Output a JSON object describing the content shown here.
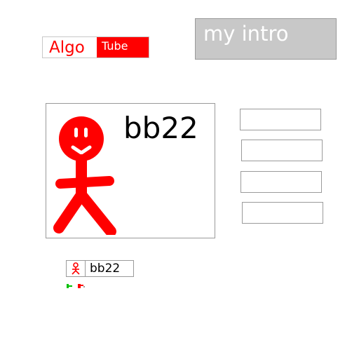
{
  "logo": {
    "part1": "Algo",
    "part2": "Tube"
  },
  "intro_button": {
    "label": "my intro"
  },
  "channel": {
    "name": "bb22",
    "avatar_icon": "stick-figure-icon",
    "avatar_color": "#ff0000"
  },
  "side_buttons": [
    {
      "label": ""
    },
    {
      "label": ""
    },
    {
      "label": ""
    },
    {
      "label": ""
    }
  ],
  "mini_chip": {
    "name": "bb22",
    "avatar_icon": "stick-figure-icon"
  },
  "reactions": {
    "like_color": "#00c000",
    "dislike_color": "#ff0000"
  },
  "colors": {
    "brand": "#ff0000",
    "button_gray": "#c8c8c8",
    "border": "#9a9a9a"
  }
}
